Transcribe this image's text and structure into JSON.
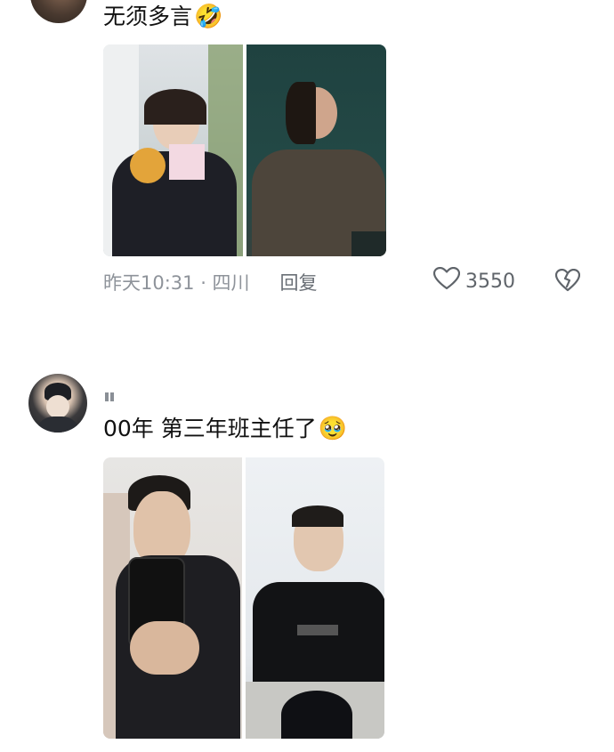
{
  "comments": [
    {
      "text": "无须多言",
      "emoji": "🤣",
      "meta": {
        "time_location": "昨天10:31 · 四川",
        "reply_label": "回复",
        "like_count": "3550"
      }
    },
    {
      "text": "00年 第三年班主任了",
      "emoji": "🥹"
    }
  ],
  "icons": {
    "like": "heart-outline-icon",
    "dislike": "broken-heart-icon"
  },
  "colors": {
    "meta_text": "#8e939a",
    "icon_stroke": "#5f646a"
  }
}
